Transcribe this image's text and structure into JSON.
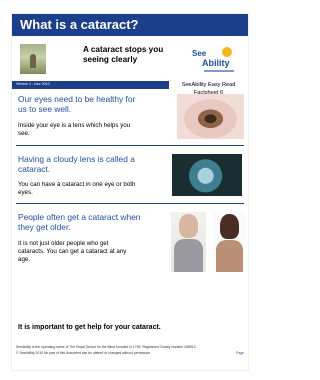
{
  "title": "What is a cataract?",
  "header": {
    "text": "A cataract stops you seeing clearly",
    "logo_see": "See",
    "logo_ability": "Ability"
  },
  "meta": {
    "version": "Version 1 - Nov 2010",
    "factsheet": "SeeAbility Easy Read Factsheet 6"
  },
  "sections": [
    {
      "heading": "Our eyes need to be healthy for us to see well.",
      "body": "Inside your eye is a lens which helps you see."
    },
    {
      "heading": "Having a cloudy lens is called a cataract.",
      "body": "You can have a cataract in one eye or both eyes."
    },
    {
      "heading": "People often get a cataract when they get older.",
      "body": "It is not just older people who get cataracts. You can get a cataract at any age."
    }
  ],
  "important": "It is important to get help for your cataract.",
  "footer": {
    "line1": "SeeAbility is the operating name of The Royal School for the Blind founded in 1799. Registered Charity Number 255913",
    "line2": "© SeeAbility 2010  No part of this document can be altered or changed without permission",
    "page": "Page"
  },
  "colors": {
    "brand_blue": "#1c3f8c",
    "heading_blue": "#1f4e9e"
  }
}
